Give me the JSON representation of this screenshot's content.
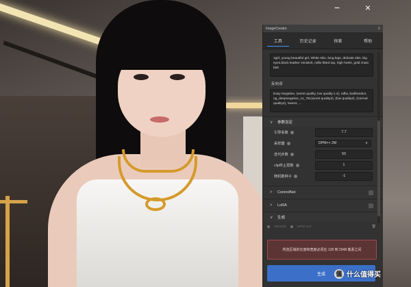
{
  "window_controls": {
    "minimize": "−",
    "close": "×"
  },
  "panel": {
    "title": "ImageCreator",
    "menu_icon": "≡",
    "tabs": [
      "工具",
      "历史记录",
      "探索",
      "帮助"
    ],
    "positive_prompt": "1girl, young beautiful girl, White skin, long legs, delicate skin, big eyes,black leather miniskirt, ndfw fitted top, high heels, gold chain belt",
    "negative_label": "反向词",
    "negative_prompt": "Easy Negative, (worst quality, low quality:1.4), ndfw, badhandv4, ng_deepnegative_v1_75t,(worst quality2), (low quality2), (normal quality2), lowers, ...",
    "params_section": {
      "chevron": "∨",
      "label": "参数设定"
    },
    "params": [
      {
        "label": "引导系数",
        "value": "7.7"
      },
      {
        "label": "采样器",
        "value": "DPM++ 2M"
      },
      {
        "label": "迭代步数",
        "value": "50"
      },
      {
        "label": "clip终止层数",
        "value": "1"
      },
      {
        "label": "随机数种子",
        "value": "-1"
      }
    ],
    "select_chevron": "∨",
    "collapsed_chevron": ">",
    "controlnet_label": "ControlNet",
    "lora_label": "LoRA",
    "generate_section": {
      "chevron": "∨",
      "label": "生成"
    },
    "history_row": {
      "date": "2024/3/9",
      "tag": "UPSCALE",
      "trash": "🗑"
    },
    "error_message": "所选区域的长度和宽度必须在 128 到 2048 像素之间",
    "generate_button": "生成"
  },
  "watermark": {
    "icon": "值",
    "text": "什么值得买"
  }
}
